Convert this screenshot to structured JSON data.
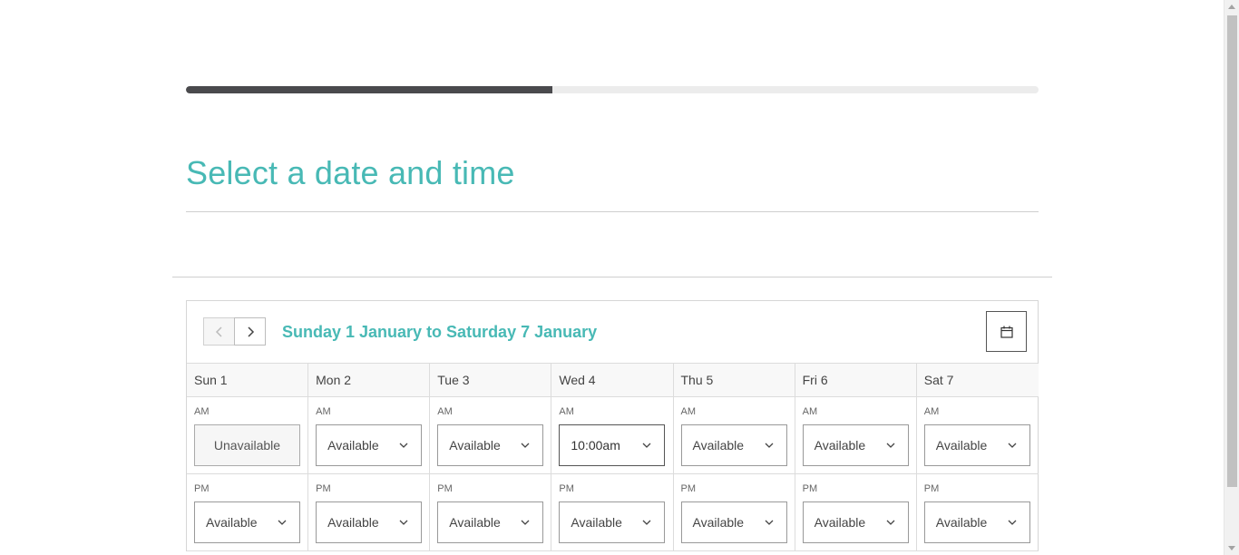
{
  "progress": {
    "fraction": 0.43
  },
  "page_title": "Select a date and time",
  "calendar": {
    "week_range": "Sunday 1 January to Saturday 7 January",
    "days": [
      {
        "label": "Sun 1",
        "am_label": "AM",
        "am_value": "Unavailable",
        "am_state": "unavailable",
        "pm_label": "PM",
        "pm_value": "Available",
        "pm_state": "available"
      },
      {
        "label": "Mon 2",
        "am_label": "AM",
        "am_value": "Available",
        "am_state": "available",
        "pm_label": "PM",
        "pm_value": "Available",
        "pm_state": "available"
      },
      {
        "label": "Tue 3",
        "am_label": "AM",
        "am_value": "Available",
        "am_state": "available",
        "pm_label": "PM",
        "pm_value": "Available",
        "pm_state": "available"
      },
      {
        "label": "Wed 4",
        "am_label": "AM",
        "am_value": "10:00am",
        "am_state": "selected",
        "pm_label": "PM",
        "pm_value": "Available",
        "pm_state": "available"
      },
      {
        "label": "Thu 5",
        "am_label": "AM",
        "am_value": "Available",
        "am_state": "available",
        "pm_label": "PM",
        "pm_value": "Available",
        "pm_state": "available"
      },
      {
        "label": "Fri 6",
        "am_label": "AM",
        "am_value": "Available",
        "am_state": "available",
        "pm_label": "PM",
        "pm_value": "Available",
        "pm_state": "available"
      },
      {
        "label": "Sat 7",
        "am_label": "AM",
        "am_value": "Available",
        "am_state": "available",
        "pm_label": "PM",
        "pm_value": "Available",
        "pm_state": "available"
      }
    ]
  },
  "icons": {
    "prev": "chevron-left-icon",
    "next": "chevron-right-icon",
    "calendar": "calendar-icon",
    "dropdown": "chevron-down-icon"
  },
  "colors": {
    "accent": "#48b9b5",
    "progress_fill": "#4a4a4d",
    "progress_track": "#ececec"
  }
}
